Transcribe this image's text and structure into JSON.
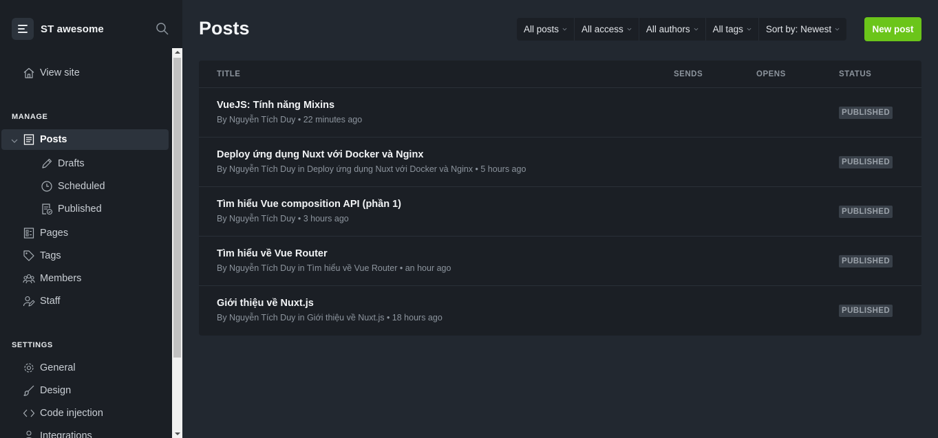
{
  "brand": {
    "name": "ST awesome",
    "logo_icon": "menu-lines-icon"
  },
  "sidebar": {
    "view_site": {
      "label": "View site",
      "icon": "home-icon"
    },
    "manage_title": "MANAGE",
    "manage_items": [
      {
        "label": "Posts",
        "icon": "posts-icon",
        "active": true
      },
      {
        "label": "Drafts",
        "icon": "pencil-icon"
      },
      {
        "label": "Scheduled",
        "icon": "clock-icon"
      },
      {
        "label": "Published",
        "icon": "published-icon"
      },
      {
        "label": "Pages",
        "icon": "pages-icon"
      },
      {
        "label": "Tags",
        "icon": "tag-icon"
      },
      {
        "label": "Members",
        "icon": "members-icon"
      },
      {
        "label": "Staff",
        "icon": "staff-icon"
      }
    ],
    "settings_title": "SETTINGS",
    "settings_items": [
      {
        "label": "General",
        "icon": "gear-icon"
      },
      {
        "label": "Design",
        "icon": "brush-icon"
      },
      {
        "label": "Code injection",
        "icon": "code-icon"
      },
      {
        "label": "Integrations",
        "icon": "integrations-icon"
      }
    ]
  },
  "header": {
    "title": "Posts",
    "filters": [
      "All posts",
      "All access",
      "All authors",
      "All tags",
      "Sort by: Newest"
    ],
    "new_post_label": "New post"
  },
  "table": {
    "columns": {
      "title": "TITLE",
      "sends": "SENDS",
      "opens": "OPENS",
      "status": "STATUS"
    },
    "rows": [
      {
        "title": "VueJS: Tính năng Mixins",
        "meta": "By Nguyễn Tích Duy • 22 minutes ago",
        "status": "PUBLISHED"
      },
      {
        "title": "Deploy ứng dụng Nuxt với Docker và Nginx",
        "meta": "By Nguyễn Tích Duy in Deploy ứng dụng Nuxt với Docker và Nginx • 5 hours ago",
        "status": "PUBLISHED"
      },
      {
        "title": "Tìm hiểu Vue composition API (phần 1)",
        "meta": "By Nguyễn Tích Duy • 3 hours ago",
        "status": "PUBLISHED"
      },
      {
        "title": "Tìm hiểu về Vue Router",
        "meta": "By Nguyễn Tích Duy in Tìm hiểu về Vue Router • an hour ago",
        "status": "PUBLISHED"
      },
      {
        "title": "Giới thiệu về Nuxt.js",
        "meta": "By Nguyễn Tích Duy in Giới thiệu về Nuxt.js • 18 hours ago",
        "status": "PUBLISHED"
      }
    ]
  },
  "colors": {
    "accent": "#6bc51a",
    "sidebar_bg": "#1b1f25",
    "main_bg": "#222830"
  }
}
